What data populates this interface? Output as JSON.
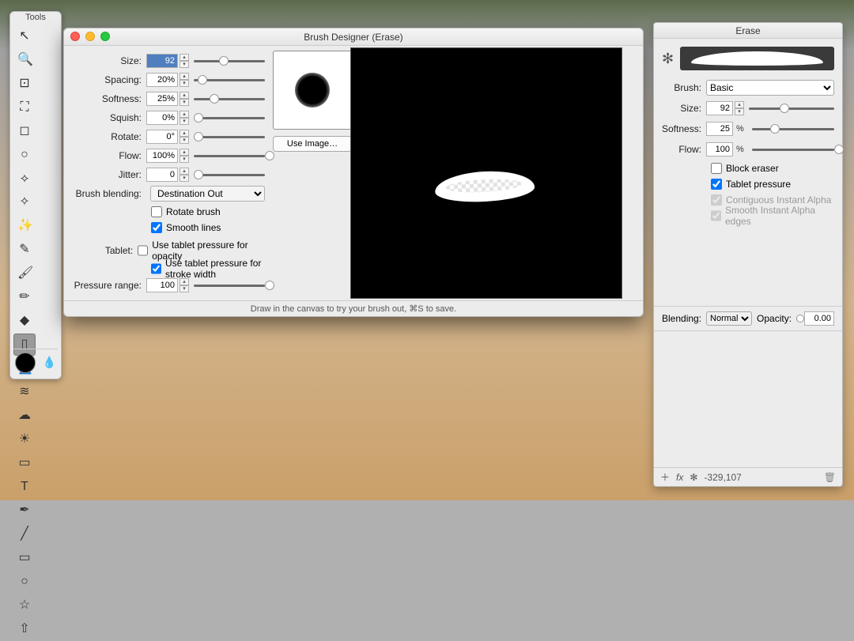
{
  "tools_palette": {
    "title": "Tools",
    "items": [
      {
        "name": "move",
        "glyph": "↖"
      },
      {
        "name": "zoom",
        "glyph": "🔍"
      },
      {
        "name": "crop",
        "glyph": "⊡"
      },
      {
        "name": "transform",
        "glyph": "⛶"
      },
      {
        "name": "rect-select",
        "glyph": "◻"
      },
      {
        "name": "ellipse-select",
        "glyph": "○"
      },
      {
        "name": "lasso",
        "glyph": "⟡"
      },
      {
        "name": "freehand-select",
        "glyph": "✧"
      },
      {
        "name": "wand",
        "glyph": "✨"
      },
      {
        "name": "pencil",
        "glyph": "✎"
      },
      {
        "name": "brush",
        "glyph": "🖌"
      },
      {
        "name": "pen",
        "glyph": "✏"
      },
      {
        "name": "fill",
        "glyph": "◆"
      },
      {
        "name": "erase",
        "glyph": "▯",
        "active": true
      },
      {
        "name": "clone",
        "glyph": "👤"
      },
      {
        "name": "smudge",
        "glyph": "≋"
      },
      {
        "name": "cloud",
        "glyph": "☁"
      },
      {
        "name": "sun",
        "glyph": "☀"
      },
      {
        "name": "gradient",
        "glyph": "▭"
      },
      {
        "name": "text",
        "glyph": "T"
      },
      {
        "name": "pen-tool",
        "glyph": "✒"
      },
      {
        "name": "line",
        "glyph": "╱"
      },
      {
        "name": "rect",
        "glyph": "▭"
      },
      {
        "name": "circle",
        "glyph": "○"
      },
      {
        "name": "star",
        "glyph": "☆"
      },
      {
        "name": "arrow",
        "glyph": "⇧"
      }
    ]
  },
  "brush_designer": {
    "title": "Brush Designer (Erase)",
    "size": {
      "label": "Size:",
      "value": "92",
      "thumb": 36
    },
    "spacing": {
      "label": "Spacing:",
      "value": "20%",
      "thumb": 6
    },
    "softness": {
      "label": "Softness:",
      "value": "25%",
      "thumb": 22
    },
    "squish": {
      "label": "Squish:",
      "value": "0%",
      "thumb": 0
    },
    "rotate": {
      "label": "Rotate:",
      "value": "0°",
      "thumb": 0
    },
    "flow": {
      "label": "Flow:",
      "value": "100%",
      "thumb": 100
    },
    "jitter": {
      "label": "Jitter:",
      "value": "0",
      "thumb": 0
    },
    "blending": {
      "label": "Brush blending:",
      "value": "Destination Out"
    },
    "rotate_brush": {
      "label": "Rotate brush",
      "checked": false
    },
    "smooth_lines": {
      "label": "Smooth lines",
      "checked": true
    },
    "tablet_label": "Tablet:",
    "tablet_opacity": {
      "label": "Use tablet pressure for opacity",
      "checked": false
    },
    "tablet_stroke": {
      "label": "Use tablet pressure for stroke width",
      "checked": true
    },
    "pressure": {
      "label": "Pressure range:",
      "value": "100",
      "thumb": 100
    },
    "use_image": "Use Image…",
    "footer": "Draw in the canvas to try your brush out, ⌘S to save."
  },
  "erase_panel": {
    "title": "Erase",
    "brush_label": "Brush:",
    "brush_value": "Basic",
    "size": {
      "label": "Size:",
      "value": "92",
      "thumb": 36
    },
    "softness": {
      "label": "Softness:",
      "value": "25",
      "unit": "%",
      "thumb": 22
    },
    "flow": {
      "label": "Flow:",
      "value": "100",
      "unit": "%",
      "thumb": 100
    },
    "block": {
      "label": "Block eraser",
      "checked": false
    },
    "tablet": {
      "label": "Tablet pressure",
      "checked": true
    },
    "contig": {
      "label": "Contiguous Instant Alpha",
      "checked": true,
      "disabled": true
    },
    "smooth": {
      "label": "Smooth Instant Alpha edges",
      "checked": true,
      "disabled": true
    },
    "blending_label": "Blending:",
    "blending_value": "Normal",
    "opacity_label": "Opacity:",
    "opacity_value": "0.00",
    "coords": "-329,107",
    "footer_icons": {
      "add": "＋",
      "fx": "fx",
      "gear": "✻",
      "trash": "🗑"
    }
  }
}
